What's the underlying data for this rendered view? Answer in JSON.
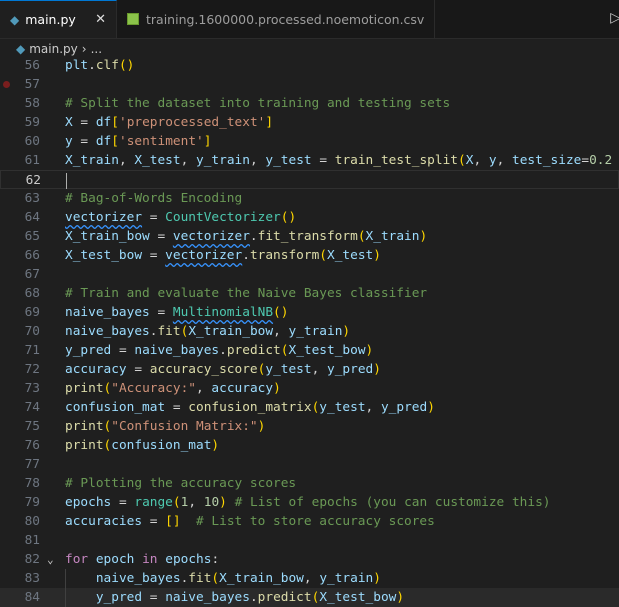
{
  "tabs": [
    {
      "label": "main.py",
      "icon": "python-icon",
      "active": true
    },
    {
      "label": "training.1600000.processed.noemoticon.csv",
      "icon": "csv-icon",
      "active": false
    }
  ],
  "breadcrumb": {
    "file": "main.py",
    "sep": "›",
    "rest": "..."
  },
  "lines": [
    {
      "n": "56",
      "t": [
        [
          "plt",
          "v"
        ],
        [
          ".",
          "o"
        ],
        [
          "clf",
          "f"
        ],
        [
          "()",
          "b"
        ]
      ]
    },
    {
      "n": "57",
      "bp": true,
      "t": []
    },
    {
      "n": "58",
      "t": [
        [
          "# Split the dataset into training and testing sets",
          "m"
        ]
      ]
    },
    {
      "n": "59",
      "t": [
        [
          "X",
          "v"
        ],
        [
          " = ",
          "o"
        ],
        [
          "df",
          "v"
        ],
        [
          "[",
          "b"
        ],
        [
          "'preprocessed_text'",
          "s"
        ],
        [
          "]",
          "b"
        ]
      ]
    },
    {
      "n": "60",
      "t": [
        [
          "y",
          "v"
        ],
        [
          " = ",
          "o"
        ],
        [
          "df",
          "v"
        ],
        [
          "[",
          "b"
        ],
        [
          "'sentiment'",
          "s"
        ],
        [
          "]",
          "b"
        ]
      ]
    },
    {
      "n": "61",
      "t": [
        [
          "X_train",
          "v"
        ],
        [
          ", ",
          "o"
        ],
        [
          "X_test",
          "v"
        ],
        [
          ", ",
          "o"
        ],
        [
          "y_train",
          "v"
        ],
        [
          ", ",
          "o"
        ],
        [
          "y_test",
          "v"
        ],
        [
          " = ",
          "o"
        ],
        [
          "train_test_split",
          "f"
        ],
        [
          "(",
          "b"
        ],
        [
          "X",
          "v"
        ],
        [
          ", ",
          "o"
        ],
        [
          "y",
          "v"
        ],
        [
          ", ",
          "o"
        ],
        [
          "test_size",
          "v"
        ],
        [
          "=",
          "o"
        ],
        [
          "0.2",
          "n"
        ]
      ]
    },
    {
      "n": "62",
      "cur": true,
      "t": []
    },
    {
      "n": "63",
      "t": [
        [
          "# Bag-of-Words Encoding",
          "m"
        ]
      ]
    },
    {
      "n": "64",
      "t": [
        [
          "vectorizer",
          "v sq"
        ],
        [
          " = ",
          "o"
        ],
        [
          "CountVectorizer",
          "c"
        ],
        [
          "()",
          "b"
        ]
      ]
    },
    {
      "n": "65",
      "t": [
        [
          "X_train_bow",
          "v"
        ],
        [
          " = ",
          "o"
        ],
        [
          "vectorizer",
          "v sq"
        ],
        [
          ".",
          "o"
        ],
        [
          "fit_transform",
          "f"
        ],
        [
          "(",
          "b"
        ],
        [
          "X_train",
          "v"
        ],
        [
          ")",
          "b"
        ]
      ]
    },
    {
      "n": "66",
      "t": [
        [
          "X_test_bow",
          "v"
        ],
        [
          " = ",
          "o"
        ],
        [
          "vectorizer",
          "v sq"
        ],
        [
          ".",
          "o"
        ],
        [
          "transform",
          "f"
        ],
        [
          "(",
          "b"
        ],
        [
          "X_test",
          "v"
        ],
        [
          ")",
          "b"
        ]
      ]
    },
    {
      "n": "67",
      "t": []
    },
    {
      "n": "68",
      "t": [
        [
          "# Train and evaluate the Naive Bayes classifier",
          "m"
        ]
      ]
    },
    {
      "n": "69",
      "t": [
        [
          "naive_bayes",
          "v"
        ],
        [
          " = ",
          "o"
        ],
        [
          "MultinomialNB",
          "c sq"
        ],
        [
          "()",
          "b"
        ]
      ]
    },
    {
      "n": "70",
      "t": [
        [
          "naive_bayes",
          "v"
        ],
        [
          ".",
          "o"
        ],
        [
          "fit",
          "f"
        ],
        [
          "(",
          "b"
        ],
        [
          "X_train_bow",
          "v"
        ],
        [
          ", ",
          "o"
        ],
        [
          "y_train",
          "v"
        ],
        [
          ")",
          "b"
        ]
      ]
    },
    {
      "n": "71",
      "t": [
        [
          "y_pred",
          "v"
        ],
        [
          " = ",
          "o"
        ],
        [
          "naive_bayes",
          "v"
        ],
        [
          ".",
          "o"
        ],
        [
          "predict",
          "f"
        ],
        [
          "(",
          "b"
        ],
        [
          "X_test_bow",
          "v"
        ],
        [
          ")",
          "b"
        ]
      ]
    },
    {
      "n": "72",
      "t": [
        [
          "accuracy",
          "v"
        ],
        [
          " = ",
          "o"
        ],
        [
          "accuracy_score",
          "f"
        ],
        [
          "(",
          "b"
        ],
        [
          "y_test",
          "v"
        ],
        [
          ", ",
          "o"
        ],
        [
          "y_pred",
          "v"
        ],
        [
          ")",
          "b"
        ]
      ]
    },
    {
      "n": "73",
      "t": [
        [
          "print",
          "f"
        ],
        [
          "(",
          "b"
        ],
        [
          "\"Accuracy:\"",
          "s"
        ],
        [
          ", ",
          "o"
        ],
        [
          "accuracy",
          "v"
        ],
        [
          ")",
          "b"
        ]
      ]
    },
    {
      "n": "74",
      "t": [
        [
          "confusion_mat",
          "v"
        ],
        [
          " = ",
          "o"
        ],
        [
          "confusion_matrix",
          "f"
        ],
        [
          "(",
          "b"
        ],
        [
          "y_test",
          "v"
        ],
        [
          ", ",
          "o"
        ],
        [
          "y_pred",
          "v"
        ],
        [
          ")",
          "b"
        ]
      ]
    },
    {
      "n": "75",
      "t": [
        [
          "print",
          "f"
        ],
        [
          "(",
          "b"
        ],
        [
          "\"Confusion Matrix:\"",
          "s"
        ],
        [
          ")",
          "b"
        ]
      ]
    },
    {
      "n": "76",
      "t": [
        [
          "print",
          "f"
        ],
        [
          "(",
          "b"
        ],
        [
          "confusion_mat",
          "v"
        ],
        [
          ")",
          "b"
        ]
      ]
    },
    {
      "n": "77",
      "t": []
    },
    {
      "n": "78",
      "t": [
        [
          "# Plotting the accuracy scores",
          "m"
        ]
      ]
    },
    {
      "n": "79",
      "t": [
        [
          "epochs",
          "v"
        ],
        [
          " = ",
          "o"
        ],
        [
          "range",
          "c"
        ],
        [
          "(",
          "b"
        ],
        [
          "1",
          "n"
        ],
        [
          ", ",
          "o"
        ],
        [
          "10",
          "n"
        ],
        [
          ")",
          "b"
        ],
        [
          " # List of epochs (you can customize this)",
          "m"
        ]
      ]
    },
    {
      "n": "80",
      "t": [
        [
          "accuracies",
          "v"
        ],
        [
          " = ",
          "o"
        ],
        [
          "[]",
          "b"
        ],
        [
          "  # List to store accuracy scores",
          "m"
        ]
      ]
    },
    {
      "n": "81",
      "t": []
    },
    {
      "n": "82",
      "fold": true,
      "t": [
        [
          "for",
          "k"
        ],
        [
          " ",
          "o"
        ],
        [
          "epoch",
          "v"
        ],
        [
          " ",
          "o"
        ],
        [
          "in",
          "k"
        ],
        [
          " ",
          "o"
        ],
        [
          "epochs",
          "v"
        ],
        [
          ":",
          "o"
        ]
      ]
    },
    {
      "n": "83",
      "ind": true,
      "t": [
        [
          "    ",
          "o"
        ],
        [
          "naive_bayes",
          "v"
        ],
        [
          ".",
          "o"
        ],
        [
          "fit",
          "f"
        ],
        [
          "(",
          "b"
        ],
        [
          "X_train_bow",
          "v"
        ],
        [
          ", ",
          "o"
        ],
        [
          "y_train",
          "v"
        ],
        [
          ")",
          "b"
        ]
      ]
    },
    {
      "n": "84",
      "ind": true,
      "hl": true,
      "t": [
        [
          "    ",
          "o"
        ],
        [
          "y_pred",
          "v"
        ],
        [
          " = ",
          "o"
        ],
        [
          "naive_bayes",
          "v"
        ],
        [
          ".",
          "o"
        ],
        [
          "predict",
          "f"
        ],
        [
          "(",
          "b"
        ],
        [
          "X_test_bow",
          "v"
        ],
        [
          ")",
          "b"
        ]
      ]
    }
  ]
}
